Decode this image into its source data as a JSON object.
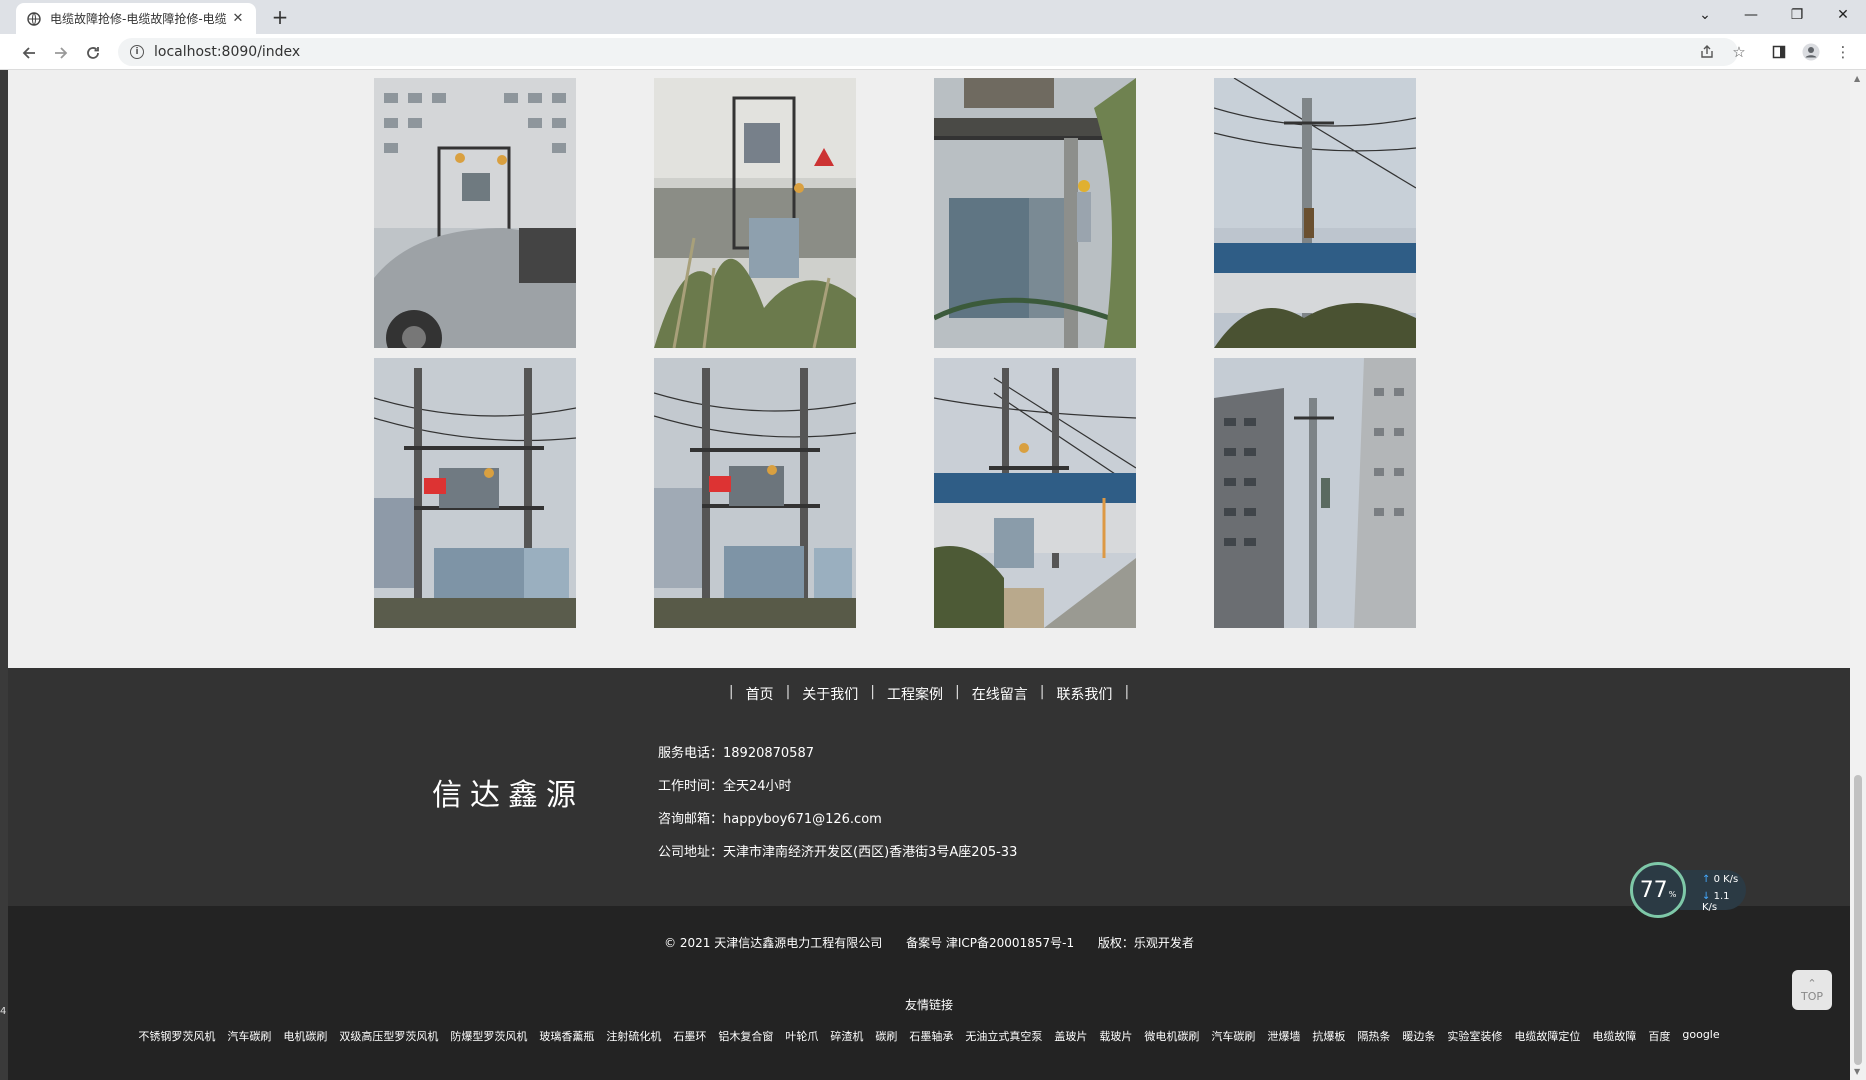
{
  "browser": {
    "tab_title": "电缆故障抢修-电缆故障抢修-电缆",
    "tab_close": "✕",
    "new_tab": "+",
    "url": "localhost:8090/index",
    "window_controls": {
      "tabs_menu": "⌄",
      "minimize": "—",
      "restore": "❐",
      "close": "✕"
    }
  },
  "gallery": {
    "photos": [
      {
        "name": "transformer-building-van"
      },
      {
        "name": "transformer-workers-overgrown"
      },
      {
        "name": "transformer-cabinet-worker"
      },
      {
        "name": "pole-climber-sky"
      },
      {
        "name": "transformer-frame-workers-1"
      },
      {
        "name": "transformer-frame-workers-2"
      },
      {
        "name": "transformer-street-worker"
      },
      {
        "name": "pole-between-towers"
      }
    ]
  },
  "footer": {
    "nav": [
      "首页",
      "关于我们",
      "工程案例",
      "在线留言",
      "联系我们"
    ],
    "separator": "|",
    "brand": "信达鑫源",
    "contact": {
      "phone": "服务电话：18920870587",
      "hours": "工作时间：全天24小时",
      "email": "咨询邮箱：happyboy671@126.com",
      "address": "公司地址：天津市津南经济开发区(西区)香港街3号A座205-33"
    },
    "copyright": "© 2021 天津信达鑫源电力工程有限公司",
    "icp": "备案号 津ICP备20001857号-1",
    "rights": "版权：乐观开发者",
    "friend_links_title": "友情链接",
    "friend_links": [
      "不锈钢罗茨风机",
      "汽车碳刷",
      "电机碳刷",
      "双级高压型罗茨风机",
      "防爆型罗茨风机",
      "玻璃香薰瓶",
      "注射硫化机",
      "石墨环",
      "铝木复合窗",
      "叶轮爪",
      "碎渣机",
      "碳刷",
      "石墨轴承",
      "无油立式真空泵",
      "盖玻片",
      "载玻片",
      "微电机碳刷",
      "汽车碳刷",
      "泄爆墙",
      "抗爆板",
      "隔热条",
      "暖边条",
      "实验室装修",
      "电缆故障定位",
      "电缆故障",
      "百度",
      "google"
    ]
  },
  "overlay": {
    "speed_percent": "77",
    "speed_unit": "%",
    "upload": "0 K/s",
    "download": "1.1 K/s",
    "top_button": "TOP",
    "edge_char": "4"
  },
  "colors": {
    "footer_top": "#333333",
    "footer_bottom": "#232323",
    "page_bg": "#efefef"
  }
}
